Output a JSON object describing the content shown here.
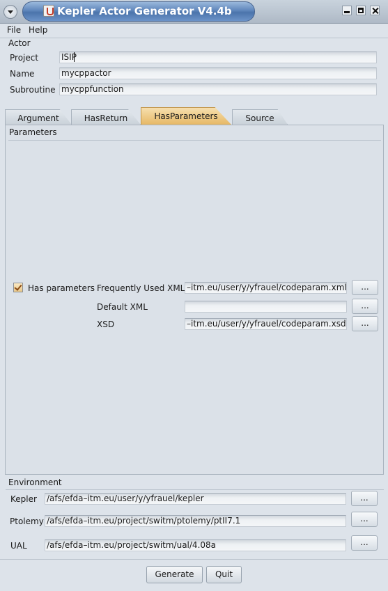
{
  "window": {
    "title": "Kepler Actor Generator V4.4b"
  },
  "menu": {
    "items": [
      "File",
      "Help"
    ]
  },
  "actor": {
    "group_label": "Actor",
    "project_label": "Project",
    "project_value": "ISIP",
    "name_label": "Name",
    "name_value": "mycppactor",
    "subroutine_label": "Subroutine",
    "subroutine_value": "mycppfunction"
  },
  "tabs": [
    {
      "label": "Argument",
      "active": false
    },
    {
      "label": "HasReturn",
      "active": false
    },
    {
      "label": "HasParameters",
      "active": true
    },
    {
      "label": "Source",
      "active": false
    }
  ],
  "parameters": {
    "group_label": "Parameters",
    "has_parameters_label": "Has parameters",
    "has_parameters_checked": true,
    "frequent_xml_label": "Frequently Used XML",
    "frequent_xml_value": "–itm.eu/user/y/yfrauel/codeparam.xml",
    "default_xml_label": "Default XML",
    "default_xml_value": "",
    "xsd_label": "XSD",
    "xsd_value": "–itm.eu/user/y/yfrauel/codeparam.xsd",
    "browse_label": "..."
  },
  "environment": {
    "group_label": "Environment",
    "kepler_label": "Kepler",
    "kepler_value": "/afs/efda–itm.eu/user/y/yfrauel/kepler",
    "ptolemy_label": "Ptolemy",
    "ptolemy_value": "/afs/efda–itm.eu/project/switm/ptolemy/ptII7.1",
    "ual_label": "UAL",
    "ual_value": "/afs/efda–itm.eu/project/switm/ual/4.08a",
    "browse_label": "..."
  },
  "actions": {
    "generate_label": "Generate",
    "quit_label": "Quit"
  },
  "icons": [
    "window-menu-icon",
    "java-app-icon",
    "minimize-icon",
    "maximize-icon",
    "close-icon",
    "checkmark-icon"
  ]
}
